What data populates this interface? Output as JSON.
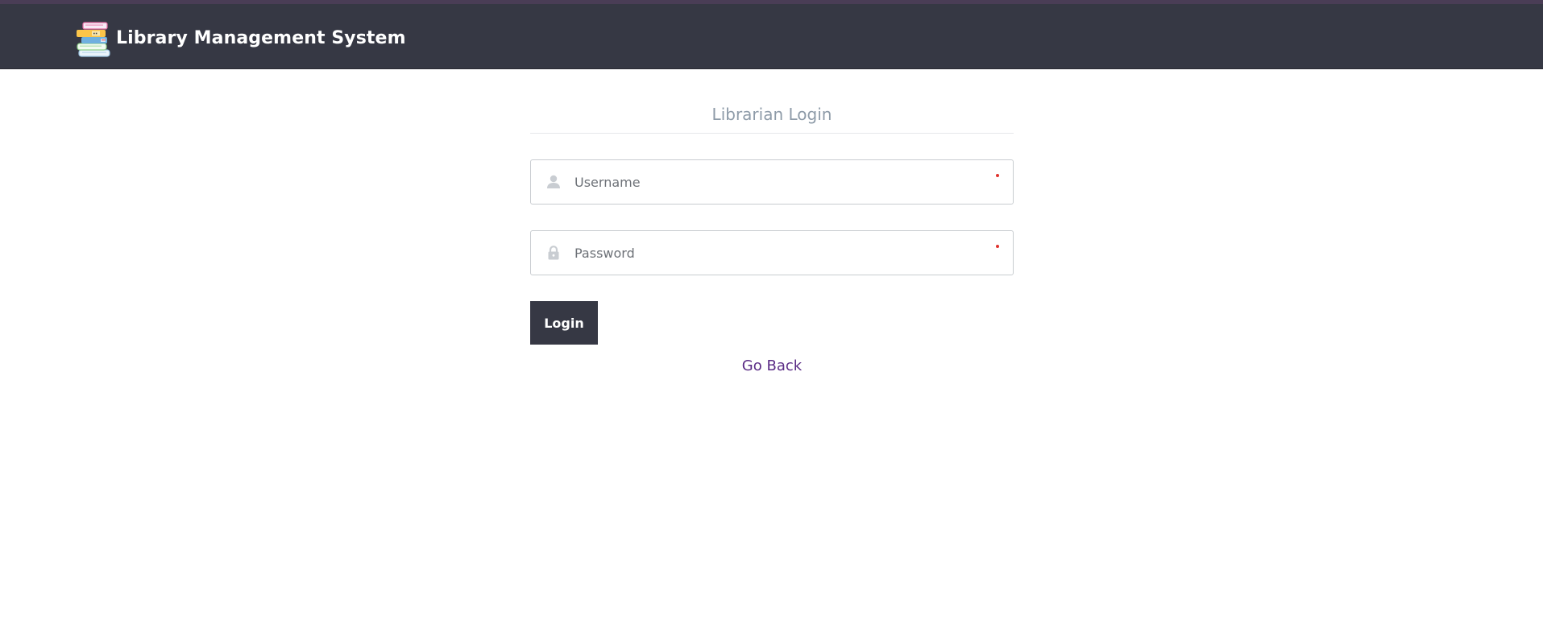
{
  "header": {
    "title": "Library Management System",
    "logo_icon": "books-stack-icon",
    "background": "#363844"
  },
  "login": {
    "heading": "Librarian Login",
    "username": {
      "placeholder": "Username",
      "value": "",
      "icon": "user-icon",
      "required": true
    },
    "password": {
      "placeholder": "Password",
      "value": "",
      "icon": "lock-icon",
      "required": true
    },
    "submit_label": "Login",
    "back_link": "Go Back"
  },
  "colors": {
    "accent": "#363844",
    "link": "#5b2c86",
    "required": "#e0332e",
    "heading": "#8e9ba8"
  }
}
